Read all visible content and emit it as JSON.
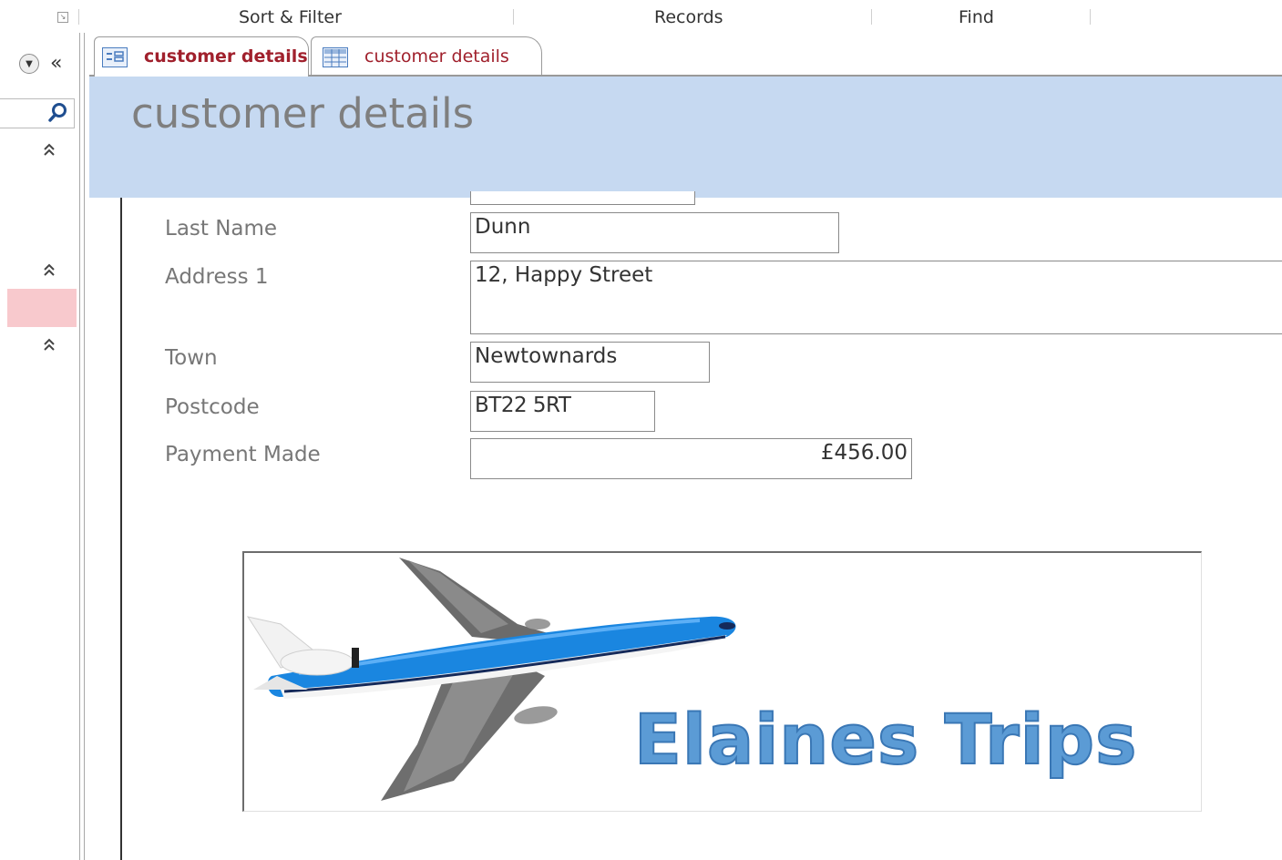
{
  "ribbon": {
    "groups": [
      "Sort & Filter",
      "Records",
      "Find"
    ]
  },
  "nav": {
    "dropdown_icon": "chevron-down-icon",
    "collapse_glyph": "«",
    "search_icon": "search-icon",
    "section_chevron": "≈"
  },
  "tabs": [
    {
      "label": "customer details",
      "type": "form"
    },
    {
      "label": "customer details",
      "type": "datasheet"
    }
  ],
  "form": {
    "title": "customer details",
    "fields": [
      {
        "label": "Last Name",
        "value": "Dunn"
      },
      {
        "label": "Address 1",
        "value": "12, Happy Street"
      },
      {
        "label": "Town",
        "value": "Newtownards"
      },
      {
        "label": "Postcode",
        "value": "BT22 5RT"
      },
      {
        "label": "Payment Made",
        "value": "£456.00"
      }
    ]
  },
  "logo": {
    "text": "Elaines  Trips"
  },
  "colors": {
    "header_band": "#c6d9f1",
    "tab_text": "#a0202c",
    "logo_blue": "#5b9bd5",
    "plane_blue": "#1a86e0",
    "nav_selected": "#f8c9cd"
  }
}
